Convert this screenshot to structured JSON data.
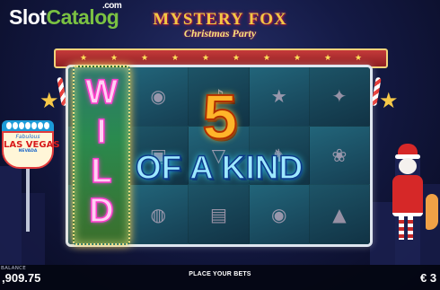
{
  "logo": {
    "slot": "Slot",
    "catalog": "Catalog",
    "domain": ".com"
  },
  "game": {
    "title": "MYSTERY FOX",
    "subtitle": "Christmas Party"
  },
  "reels": {
    "wild_letters": [
      "W",
      "I",
      "L",
      "D"
    ],
    "symbols": [
      [
        "",
        "ornament-icon",
        "bell-icon",
        "star-icon"
      ],
      [
        "",
        "gift-icon",
        "glass-icon",
        "fox-icon"
      ],
      [
        "",
        "show-icon",
        "box-icon",
        "ornament-icon"
      ]
    ]
  },
  "win": {
    "count": "5",
    "caption": "OF A KIND"
  },
  "vegas_sign": {
    "welcome": "WELCOME",
    "fabulous": "Fabulous",
    "city": "LAS VEGAS",
    "state": "NEVADA"
  },
  "footer": {
    "balance_label": "BALANCE",
    "balance_value": ",909.75",
    "message": "PLACE YOUR BETS",
    "bet_value": "€ 3"
  },
  "colors": {
    "logo_green": "#7ac142",
    "win_orange": "#ffb52a",
    "caption_blue": "#9de8ff",
    "wild_pink": "#ff3cc8"
  }
}
